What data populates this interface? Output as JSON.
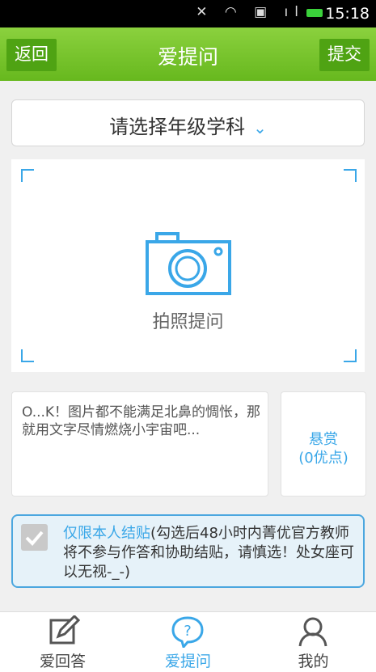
{
  "statusbar": {
    "time": "15:18"
  },
  "header": {
    "title": "爱提问",
    "back_label": "返回",
    "submit_label": "提交"
  },
  "grade_selector": {
    "label": "请选择年级学科",
    "chevron": "⌄"
  },
  "photo": {
    "label": "拍照提问",
    "icon": "camera-icon"
  },
  "question": {
    "placeholder": "O...K！图片都不能满足北鼻的惆怅，那就用文字尽情燃烧小宇宙吧..."
  },
  "reward": {
    "line1": "悬赏",
    "line2": "(0优点)"
  },
  "notice": {
    "highlight": "仅限本人结贴",
    "text": "(勾选后48小时内菁优官方教师将不参与作答和协助结贴，请慎选！处女座可以无视-_-)",
    "checked": false
  },
  "nav": [
    {
      "label": "爱回答",
      "icon": "edit-icon",
      "active": false
    },
    {
      "label": "爱提问",
      "icon": "question-icon",
      "active": true
    },
    {
      "label": "我的",
      "icon": "user-icon",
      "active": false
    }
  ],
  "colors": {
    "accent": "#3aa7e8",
    "header_green": "#67b81e",
    "button_green": "#4fa313"
  }
}
